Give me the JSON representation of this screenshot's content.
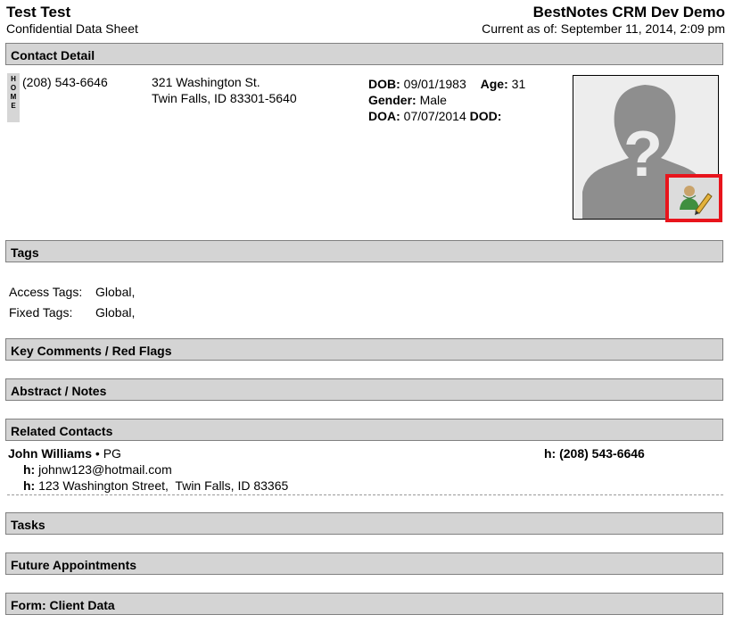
{
  "header": {
    "name": "Test Test",
    "subtitle": "Confidential Data Sheet",
    "brand": "BestNotes CRM Dev Demo",
    "current_as_of": "Current as of: September 11, 2014, 2:09 pm"
  },
  "contact_detail": {
    "section_title": "Contact Detail",
    "phone_type_badge": "H\nO\nM\nE",
    "phone": "(208) 543-6646",
    "address_line1": "321 Washington St.",
    "address_line2": "Twin Falls, ID 83301-5640",
    "dob_label": "DOB:",
    "dob_value": "09/01/1983",
    "age_label": "Age:",
    "age_value": "31",
    "gender_label": "Gender:",
    "gender_value": "Male",
    "doa_label": "DOA:",
    "doa_value": "07/07/2014",
    "dod_label": "DOD:"
  },
  "tags": {
    "section_title": "Tags",
    "access_label": "Access Tags:",
    "access_value": "Global,",
    "fixed_label": "Fixed Tags:",
    "fixed_value": "Global,"
  },
  "sections": {
    "key_comments": "Key Comments / Red Flags",
    "abstract": "Abstract / Notes",
    "related_contacts": "Related Contacts",
    "tasks": "Tasks",
    "future_appointments": "Future Appointments",
    "form_client_data": "Form: Client Data"
  },
  "related_contacts": [
    {
      "name": "John Williams",
      "relationship": "• PG",
      "phone_label": "h:",
      "phone": "(208) 543-6646",
      "email_label": "h:",
      "email": "johnw123@hotmail.com",
      "address_label": "h:",
      "address": "123 Washington Street,  Twin Falls, ID 83365"
    }
  ],
  "icons": {
    "photo": "silhouette-placeholder-icon",
    "edit_photo": "edit-person-pencil-icon"
  },
  "colors": {
    "section_bg": "#d4d4d4",
    "highlight_border": "#e8141c"
  }
}
